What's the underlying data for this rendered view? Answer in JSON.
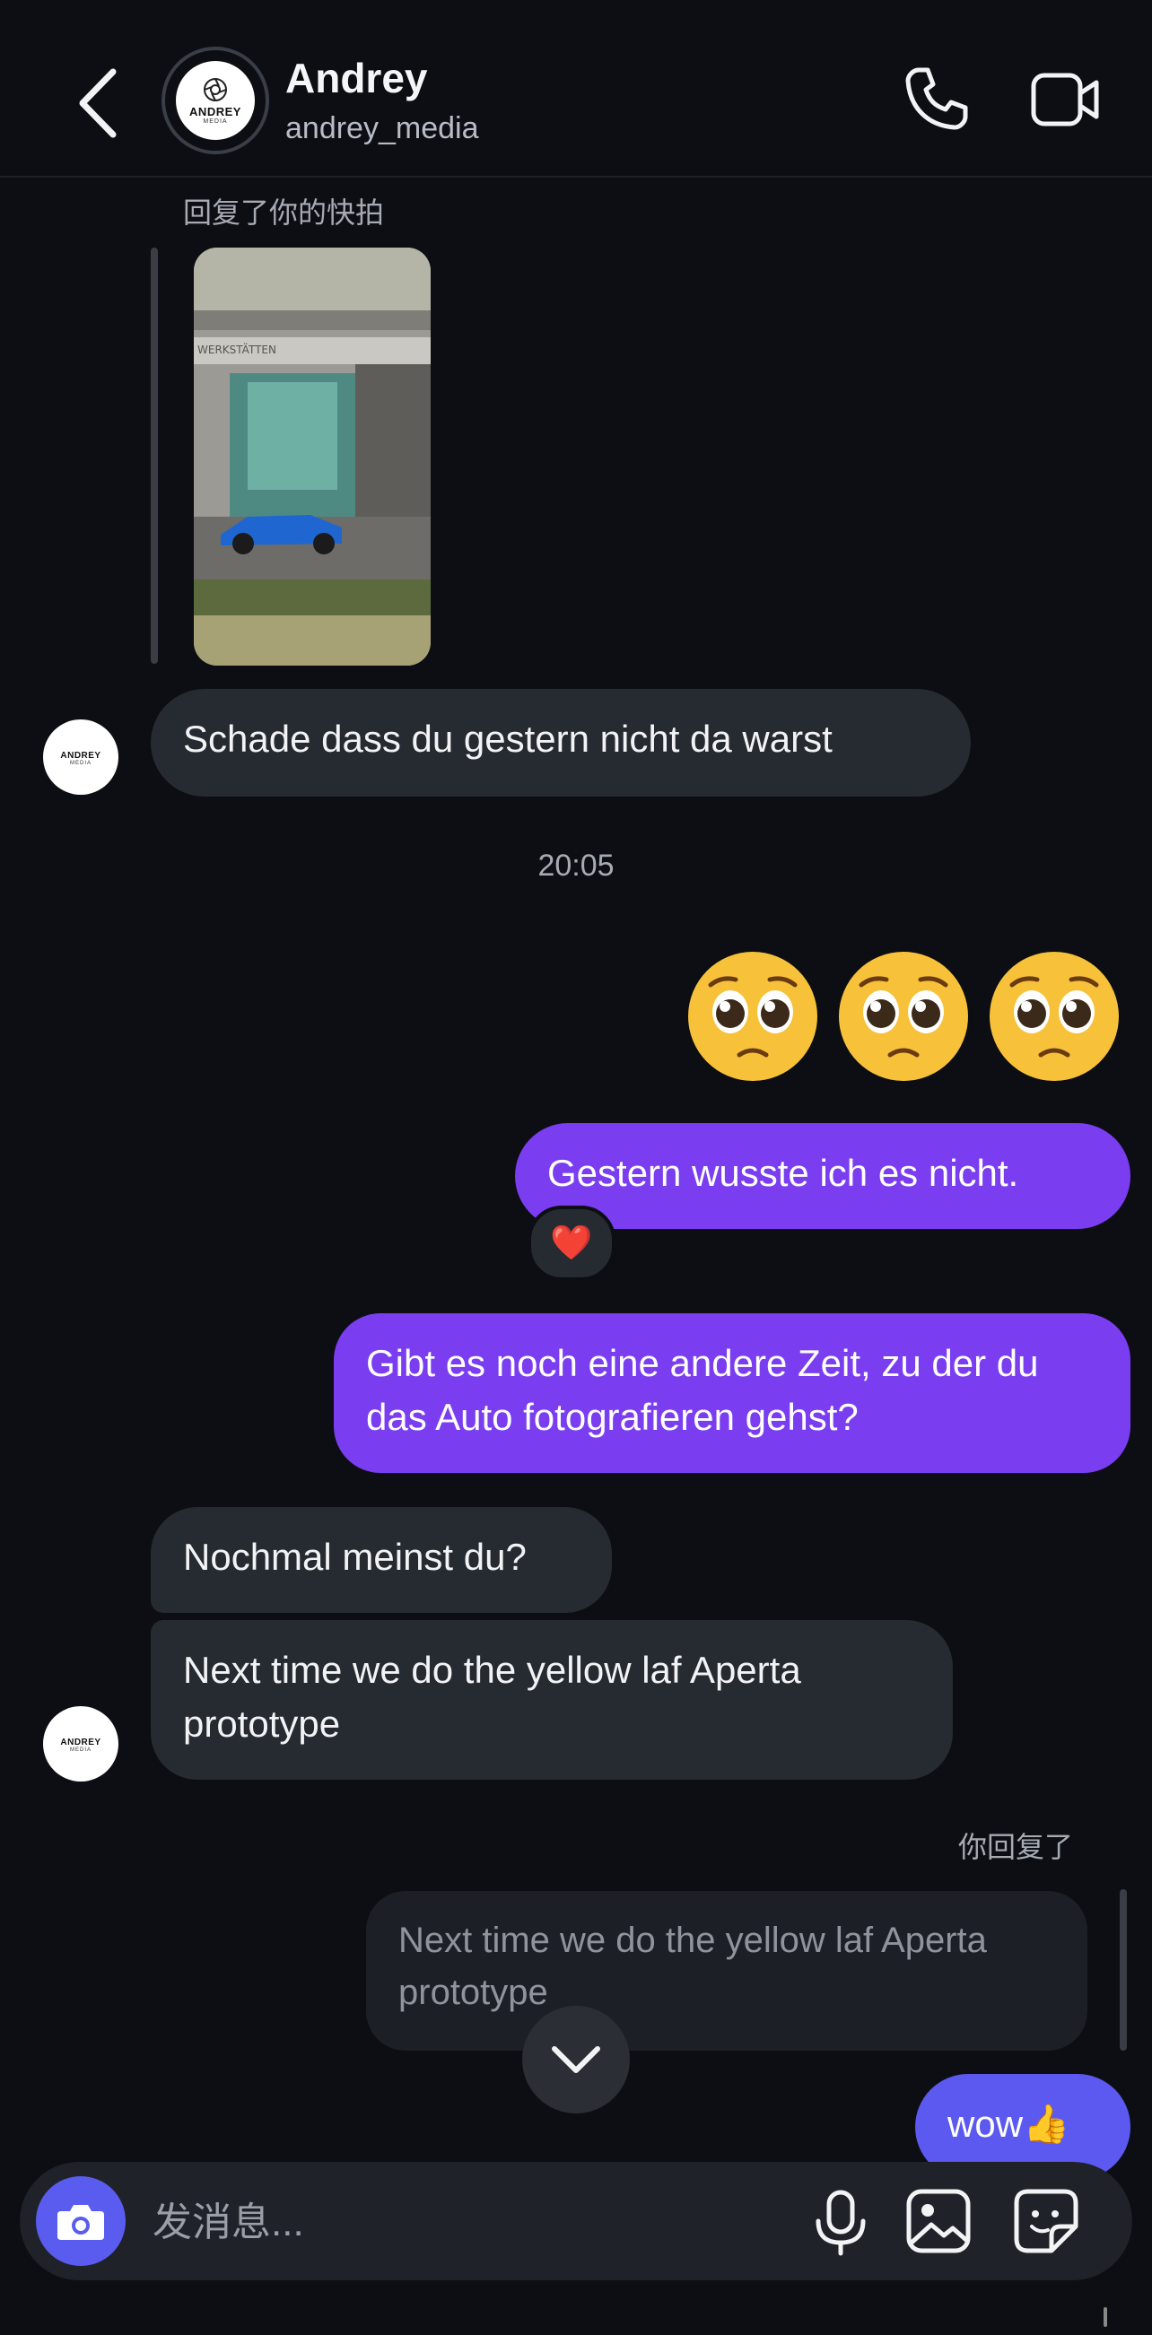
{
  "header": {
    "contact_name": "Andrey",
    "contact_handle": "andrey_media",
    "avatar_logo_text": "ANDREY",
    "avatar_logo_sub": "MEDIA"
  },
  "messages": {
    "snap_reply_note": "回复了你的快拍",
    "snap_sign_text": "WERKSTÄTTEN",
    "m1": "Schade dass du gestern nicht da warst",
    "timestamp": "20:05",
    "emojis": [
      "pleading-face",
      "pleading-face",
      "pleading-face"
    ],
    "m2": "Gestern wusste ich es nicht.",
    "m2_reaction": "❤️",
    "m3": "Gibt es noch eine andere Zeit, zu der du das Auto fotografieren gehst?",
    "m4": "Nochmal meinst du?",
    "m5": "Next time we do the yellow laf Aperta prototype",
    "you_replied_note": "你回复了",
    "quoted_text": "Next time we do the yellow laf Aperta prototype",
    "m6": "wow👍"
  },
  "composer": {
    "placeholder": "发消息..."
  },
  "colors": {
    "background": "#0c0e13",
    "incoming_bubble": "#262a31",
    "outgoing_bubble": "#7a3df0",
    "camera_button": "#5a5cf0"
  }
}
